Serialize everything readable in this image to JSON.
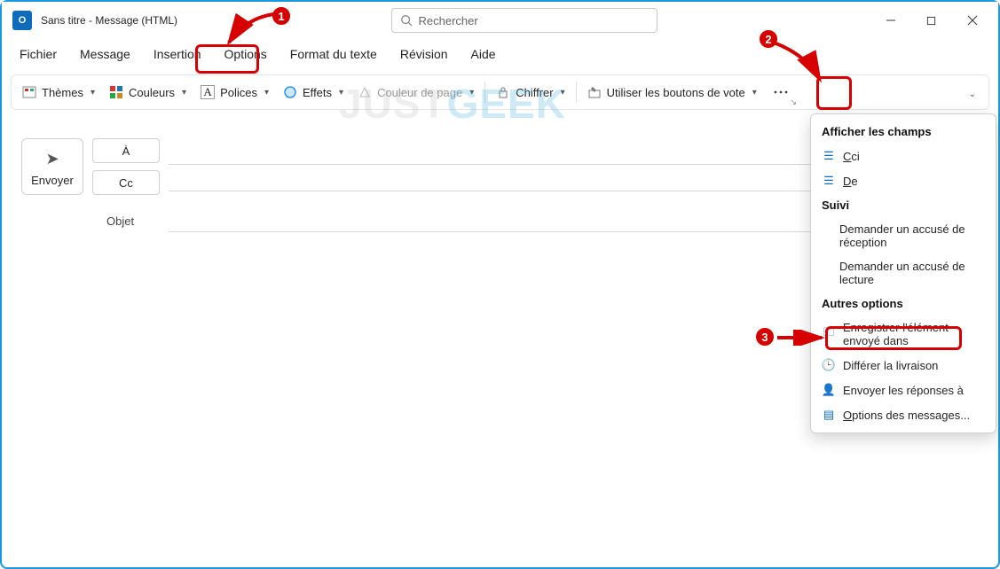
{
  "window": {
    "title": "Sans titre  -  Message (HTML)",
    "app_icon_label": "O"
  },
  "search": {
    "placeholder": "Rechercher"
  },
  "menus": {
    "fichier": "Fichier",
    "message": "Message",
    "insertion": "Insertion",
    "options": "Options",
    "format": "Format du texte",
    "revision": "Révision",
    "aide": "Aide"
  },
  "ribbon": {
    "themes": "Thèmes",
    "couleurs": "Couleurs",
    "polices": "Polices",
    "effets": "Effets",
    "couleur_page": "Couleur de page",
    "chiffrer": "Chiffrer",
    "boutons_vote": "Utiliser les boutons de vote",
    "more_aria": "Autres options"
  },
  "compose": {
    "send": "Envoyer",
    "to": "À",
    "cc": "Cc",
    "subject_label": "Objet"
  },
  "overflow": {
    "header1": "Afficher les champs",
    "cci": "Cci",
    "de": "De",
    "header2": "Suivi",
    "accuse_reception": "Demander un accusé de réception",
    "accuse_lecture": "Demander un accusé de lecture",
    "header3": "Autres options",
    "enregistrer": "Enregistrer l'élément envoyé dans",
    "differer": "Différer la livraison",
    "reponses": "Envoyer les réponses à",
    "options_msg": "Options des messages..."
  },
  "annotations": {
    "b1": "1",
    "b2": "2",
    "b3": "3"
  },
  "watermark": {
    "part1": "JUST",
    "part2": "GEEK"
  }
}
